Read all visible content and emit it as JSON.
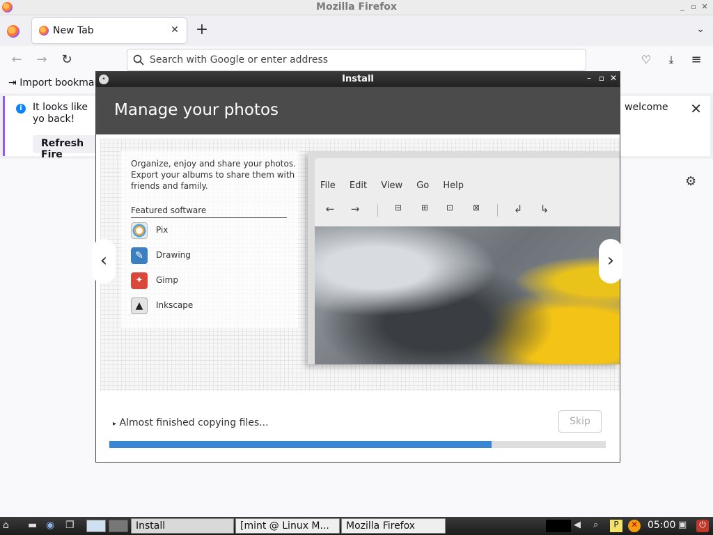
{
  "firefox": {
    "window_title": "Mozilla Firefox",
    "tab_label": "New Tab",
    "url_placeholder": "Search with Google or enter address",
    "bookmark_import": "Import bookmar",
    "notice_text": "It looks like yo back!",
    "notice_text_right": "welcome",
    "refresh_label": "Refresh Fire"
  },
  "installer": {
    "window_title": "Install",
    "header": "Manage your photos",
    "description": "Organize, enjoy and share your photos. Export your albums to share them with friends and family.",
    "featured_title": "Featured software",
    "apps": [
      {
        "name": "Pix",
        "icon": "pix-icon"
      },
      {
        "name": "Drawing",
        "icon": "drawing-icon"
      },
      {
        "name": "Gimp",
        "icon": "gimp-icon"
      },
      {
        "name": "Inkscape",
        "icon": "inkscape-icon"
      }
    ],
    "screenshot_menu": [
      "File",
      "Edit",
      "View",
      "Go",
      "Help"
    ],
    "status": "Almost finished copying files...",
    "skip_label": "Skip",
    "progress": 0.77,
    "accent_color": "#3a86d6"
  },
  "taskbar": {
    "tasks": [
      "Install",
      "[mint @ Linux M...",
      "Mozilla Firefox"
    ],
    "clock": "05:00"
  }
}
